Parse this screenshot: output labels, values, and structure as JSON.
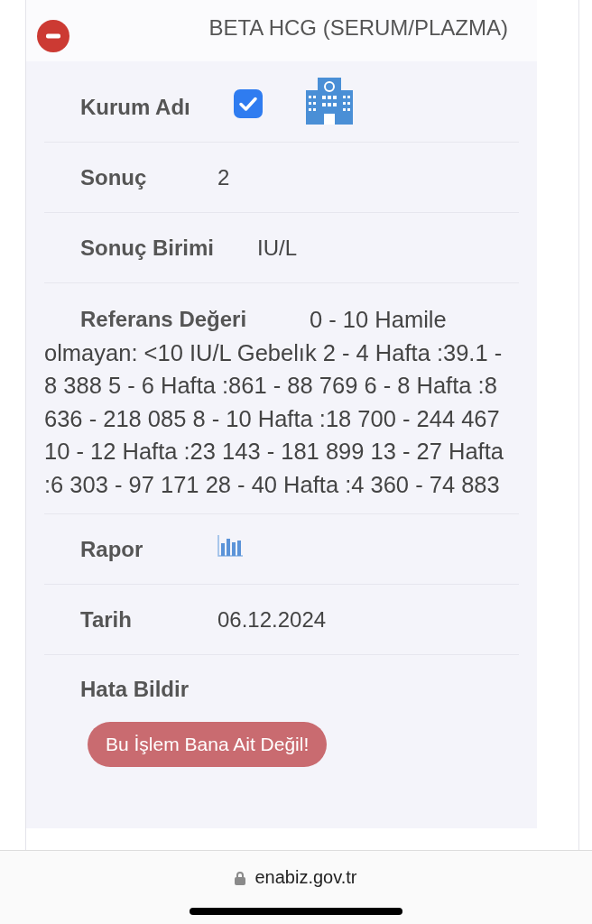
{
  "header": {
    "title": "BETA HCG (SERUM/PLAZMA)",
    "expanded": true
  },
  "rows": [
    {
      "kind": "checkbox",
      "label": "Kurum Adı",
      "checked": true
    },
    {
      "kind": "text",
      "label": "Sonuç",
      "value": "2"
    },
    {
      "kind": "text",
      "label": "Sonuç Birimi",
      "value": "IU/L"
    },
    {
      "kind": "paragraph",
      "label": "Referans Değeri",
      "value": "0 - 10 Hamile olmayan: <10 IU/L Gebelık 2 - 4 Hafta :39.1 - 8 388 5 - 6 Hafta :861 - 88 769 6 - 8 Hafta :8 636 - 218 085 8 - 10 Hafta :18 700 - 244 467 10 - 12 Hafta :23 143 - 181 899 13 - 27 Hafta :6 303 - 97 171 28 - 40 Hafta :4 360 - 74 883"
    },
    {
      "kind": "chart_icon",
      "label": "Rapor"
    },
    {
      "kind": "text",
      "label": "Tarih",
      "value": "06.12.2024"
    },
    {
      "kind": "button",
      "label": "Hata Bildir",
      "button": "Bu İşlem Bana Ait Değil!"
    }
  ],
  "browser": {
    "url": "enabiz.gov.tr"
  }
}
